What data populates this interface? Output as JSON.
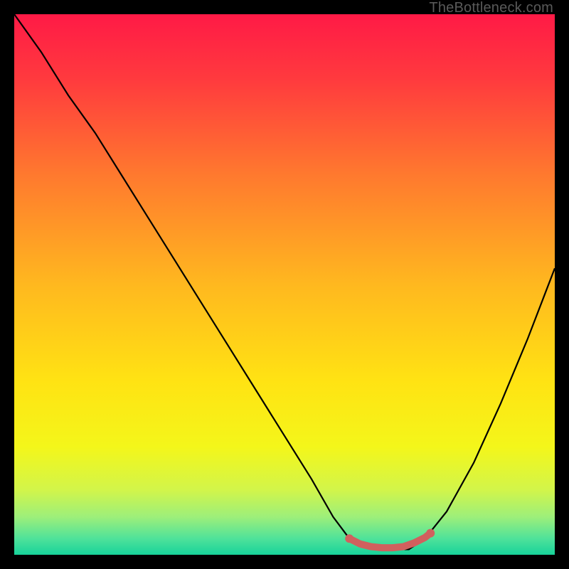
{
  "watermark": "TheBottleneck.com",
  "chart_data": {
    "type": "line",
    "title": "",
    "xlabel": "",
    "ylabel": "",
    "xlim": [
      0,
      100
    ],
    "ylim": [
      0,
      100
    ],
    "background_gradient_stops": [
      {
        "offset": 0.0,
        "color": "#ff1a46"
      },
      {
        "offset": 0.12,
        "color": "#ff3a3e"
      },
      {
        "offset": 0.3,
        "color": "#ff7a2e"
      },
      {
        "offset": 0.5,
        "color": "#ffb81f"
      },
      {
        "offset": 0.68,
        "color": "#ffe313"
      },
      {
        "offset": 0.8,
        "color": "#f4f61a"
      },
      {
        "offset": 0.88,
        "color": "#d2f54a"
      },
      {
        "offset": 0.93,
        "color": "#9def7a"
      },
      {
        "offset": 0.97,
        "color": "#4fe29a"
      },
      {
        "offset": 1.0,
        "color": "#17d39a"
      }
    ],
    "series": [
      {
        "name": "bottleneck-curve",
        "color": "#000000",
        "x": [
          0,
          5,
          10,
          15,
          20,
          25,
          30,
          35,
          40,
          45,
          50,
          55,
          59,
          62,
          66,
          70,
          73,
          76,
          80,
          85,
          90,
          95,
          100
        ],
        "y": [
          100,
          93,
          85,
          78,
          70,
          62,
          54,
          46,
          38,
          30,
          22,
          14,
          7,
          3,
          1,
          1,
          1,
          3,
          8,
          17,
          28,
          40,
          53
        ]
      }
    ],
    "highlight_segment": {
      "name": "optimal-range",
      "color": "#d1605e",
      "x": [
        62,
        64,
        66,
        68,
        70,
        72,
        74,
        76,
        77
      ],
      "y": [
        3,
        2,
        1.5,
        1.3,
        1.3,
        1.5,
        2.2,
        3.2,
        4
      ]
    }
  }
}
